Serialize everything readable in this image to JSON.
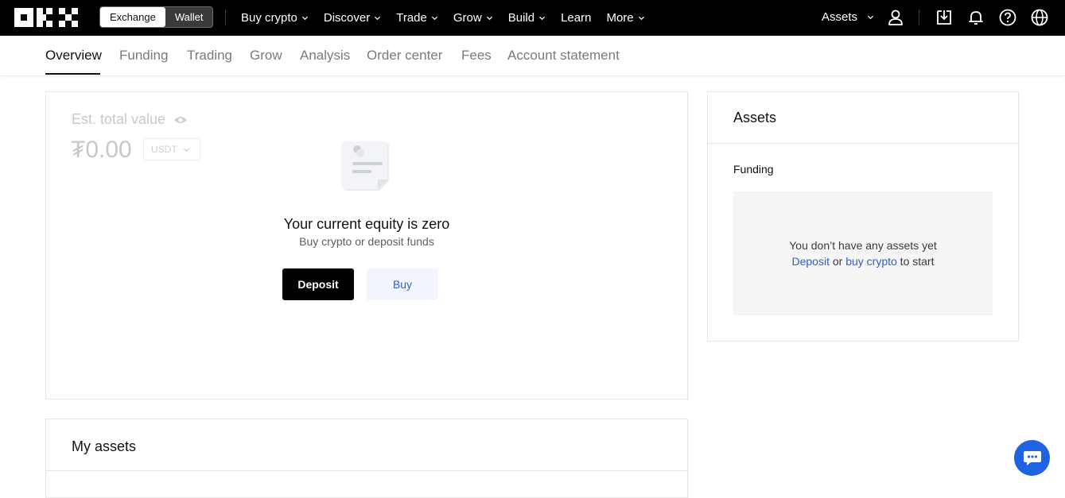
{
  "header": {
    "logo_icon": "okx-logo-icon",
    "mode_switch": {
      "exchange": "Exchange",
      "wallet": "Wallet",
      "active": "Exchange"
    },
    "nav": [
      {
        "label": "Buy crypto",
        "has_dropdown": true
      },
      {
        "label": "Discover",
        "has_dropdown": true
      },
      {
        "label": "Trade",
        "has_dropdown": true
      },
      {
        "label": "Grow",
        "has_dropdown": true
      },
      {
        "label": "Build",
        "has_dropdown": true
      },
      {
        "label": "Learn",
        "has_dropdown": false
      },
      {
        "label": "More",
        "has_dropdown": true
      }
    ],
    "assets_label": "Assets",
    "icons": [
      "user-icon",
      "download-icon",
      "bell-icon",
      "help-icon",
      "globe-icon"
    ]
  },
  "tabs": {
    "items": [
      "Overview",
      "Funding",
      "Trading",
      "Grow",
      "Analysis",
      "Order center",
      "Fees",
      "Account statement"
    ],
    "active": "Overview"
  },
  "overview": {
    "est_label": "Est. total value",
    "est_value": "₮0.00",
    "currency": "USDT",
    "empty_title": "Your current equity is zero",
    "empty_subtitle": "Buy crypto or deposit funds",
    "deposit_label": "Deposit",
    "buy_label": "Buy"
  },
  "assets_panel": {
    "title": "Assets",
    "funding_label": "Funding",
    "empty_line1": "You don’t have any assets yet",
    "deposit_link": "Deposit",
    "or_text": " or ",
    "buy_link": "buy crypto",
    "to_start": " to start"
  },
  "my_assets": {
    "title": "My assets"
  },
  "colors": {
    "topbar": "#000000",
    "link_blue": "#2f5fc9",
    "chat_button": "#1f63e0"
  }
}
